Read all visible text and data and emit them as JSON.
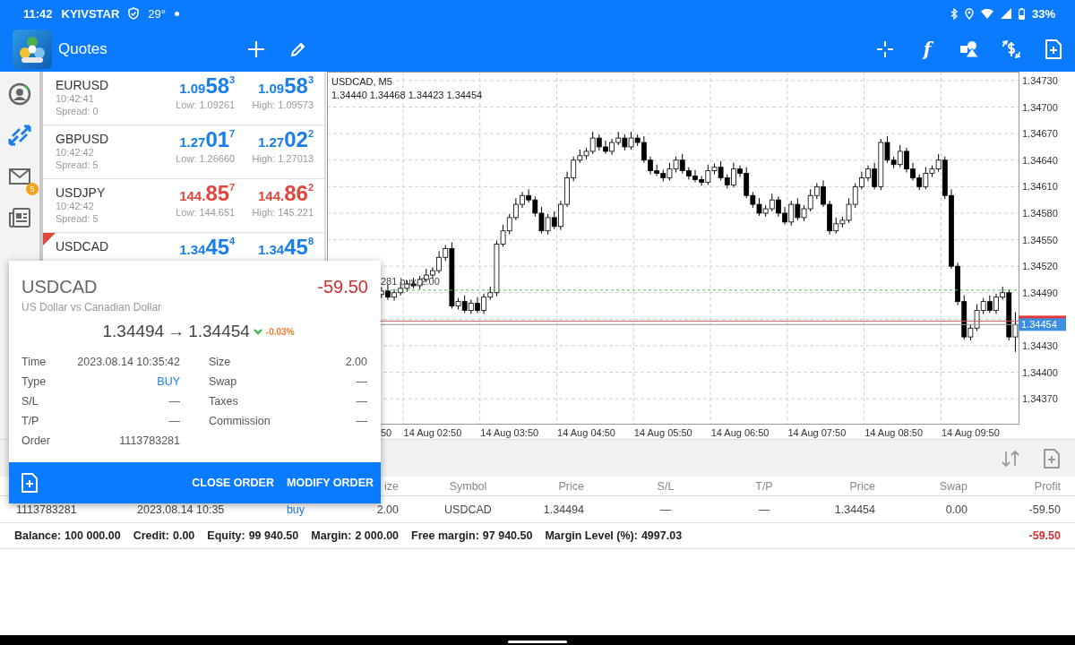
{
  "status_bar": {
    "time": "11:42",
    "carrier": "KYIVSTAR",
    "temperature": "29°",
    "battery": "33%"
  },
  "app_bar": {
    "title": "Quotes",
    "indicator_glyph": "f"
  },
  "side_nav": [
    {
      "kind": "account",
      "selected": false
    },
    {
      "kind": "trade",
      "selected": true
    },
    {
      "kind": "mail",
      "selected": false,
      "badge": "5"
    },
    {
      "kind": "news",
      "selected": false
    }
  ],
  "quotes": [
    {
      "symbol": "EURUSD",
      "time": "10:42:41",
      "spread": "Spread: 0",
      "color": "#1a7ee8",
      "flagged": false,
      "bid": {
        "head": "1.09",
        "pips": "58",
        "point": "3"
      },
      "ask": {
        "head": "1.09",
        "pips": "58",
        "point": "3"
      },
      "low": "Low: 1.09261",
      "high": "High: 1.09573"
    },
    {
      "symbol": "GBPUSD",
      "time": "10:42:42",
      "spread": "Spread: 5",
      "color": "#1a7ee8",
      "flagged": false,
      "bid": {
        "head": "1.27",
        "pips": "01",
        "point": "7"
      },
      "ask": {
        "head": "1.27",
        "pips": "02",
        "point": "2"
      },
      "low": "Low: 1.26660",
      "high": "High: 1.27013"
    },
    {
      "symbol": "USDJPY",
      "time": "10:42:42",
      "spread": "Spread: 5",
      "color": "#e0473c",
      "flagged": false,
      "bid": {
        "head": "144.",
        "pips": "85",
        "point": "7"
      },
      "ask": {
        "head": "144.",
        "pips": "86",
        "point": "2"
      },
      "low": "Low: 144.651",
      "high": "High: 145.221"
    },
    {
      "symbol": "USDCAD",
      "color": "#1a7ee8",
      "flagged": true,
      "bid": {
        "head": "1.34",
        "pips": "45",
        "point": "4"
      },
      "ask": {
        "head": "1.34",
        "pips": "45",
        "point": "8"
      }
    }
  ],
  "chart": {
    "ohlc_text": "1.34440 1.34468 1.34423 1.34454",
    "cut_axis_label": "50",
    "chart_data": {
      "type": "candlestick",
      "title": "USDCAD, M5",
      "grid": true,
      "categories": [
        null,
        null,
        null,
        null,
        null,
        null,
        null,
        null,
        null,
        null,
        null,
        null,
        null,
        null,
        null,
        null,
        "14 Aug 02:50",
        null,
        null,
        null,
        null,
        null,
        null,
        null,
        null,
        null,
        null,
        null,
        "14 Aug 03:50",
        null,
        null,
        null,
        null,
        null,
        null,
        null,
        null,
        null,
        null,
        null,
        "14 Aug 04:50",
        null,
        null,
        null,
        null,
        null,
        null,
        null,
        null,
        null,
        null,
        null,
        "14 Aug 05:50",
        null,
        null,
        null,
        null,
        null,
        null,
        null,
        null,
        null,
        null,
        null,
        "14 Aug 06:50",
        null,
        null,
        null,
        null,
        null,
        null,
        null,
        null,
        null,
        null,
        null,
        "14 Aug 07:50",
        null,
        null,
        null,
        null,
        null,
        null,
        null,
        null,
        null,
        null,
        null,
        "14 Aug 08:50",
        null,
        null,
        null,
        null,
        null,
        null,
        null,
        null,
        null,
        null,
        null,
        "14 Aug 09:50",
        null,
        null,
        null,
        null,
        null,
        null,
        null
      ],
      "ohlc": [
        null,
        null,
        null,
        null,
        null,
        null,
        null,
        null,
        [
          1.34488,
          1.34496,
          1.34484,
          1.34492
        ],
        [
          1.34492,
          1.34499,
          1.34482,
          1.34485
        ],
        [
          1.34485,
          1.34494,
          1.34481,
          1.3449
        ],
        [
          1.3449,
          1.34502,
          1.34487,
          1.34495
        ],
        [
          1.34495,
          1.34504,
          1.34491,
          1.345
        ],
        [
          1.345,
          1.34507,
          1.34495,
          1.34498
        ],
        [
          1.34498,
          1.34509,
          1.34494,
          1.34505
        ],
        [
          1.34505,
          1.34517,
          1.34502,
          1.3451
        ],
        [
          1.3451,
          1.34519,
          1.34506,
          1.34515
        ],
        [
          1.34515,
          1.34537,
          1.34512,
          1.3453
        ],
        [
          1.3453,
          1.34544,
          1.34526,
          1.3454
        ],
        [
          1.3454,
          1.34547,
          1.34472,
          1.34475
        ],
        [
          1.34475,
          1.34484,
          1.34471,
          1.3448
        ],
        [
          1.3448,
          1.34487,
          1.34467,
          1.3447
        ],
        [
          1.3447,
          1.34482,
          1.34466,
          1.34478
        ],
        [
          1.34478,
          1.34485,
          1.34467,
          1.3447
        ],
        [
          1.3447,
          1.34489,
          1.34466,
          1.34485
        ],
        [
          1.34485,
          1.34497,
          1.34482,
          1.3449
        ],
        [
          1.3449,
          1.34549,
          1.34486,
          1.34545
        ],
        [
          1.34545,
          1.34567,
          1.34542,
          1.3456
        ],
        [
          1.3456,
          1.34579,
          1.34556,
          1.34575
        ],
        [
          1.34575,
          1.34597,
          1.34572,
          1.3459
        ],
        [
          1.3459,
          1.34604,
          1.34586,
          1.346
        ],
        [
          1.346,
          1.34607,
          1.34592,
          1.34595
        ],
        [
          1.34595,
          1.34599,
          1.34576,
          1.3458
        ],
        [
          1.3458,
          1.34587,
          1.34557,
          1.3456
        ],
        [
          1.3456,
          1.34579,
          1.34556,
          1.34575
        ],
        [
          1.34575,
          1.34582,
          1.34562,
          1.34565
        ],
        [
          1.34565,
          1.34594,
          1.34561,
          1.3459
        ],
        [
          1.3459,
          1.34627,
          1.34587,
          1.3462
        ],
        [
          1.3462,
          1.34644,
          1.34616,
          1.3464
        ],
        [
          1.3464,
          1.34652,
          1.34637,
          1.34645
        ],
        [
          1.34645,
          1.34654,
          1.34641,
          1.3465
        ],
        [
          1.3465,
          1.34672,
          1.34647,
          1.34665
        ],
        [
          1.34665,
          1.34669,
          1.34651,
          1.34655
        ],
        [
          1.34655,
          1.34662,
          1.34647,
          1.3465
        ],
        [
          1.3465,
          1.34664,
          1.34646,
          1.3466
        ],
        [
          1.3466,
          1.34672,
          1.34657,
          1.34665
        ],
        [
          1.34665,
          1.34669,
          1.34651,
          1.34655
        ],
        [
          1.34655,
          1.34672,
          1.34652,
          1.34665
        ],
        [
          1.34665,
          1.34669,
          1.34656,
          1.3466
        ],
        [
          1.3466,
          1.34667,
          1.34637,
          1.3464
        ],
        [
          1.3464,
          1.34644,
          1.34624,
          1.34628
        ],
        [
          1.34628,
          1.34635,
          1.34622,
          1.34625
        ],
        [
          1.34625,
          1.34629,
          1.34616,
          1.3462
        ],
        [
          1.3462,
          1.34637,
          1.34617,
          1.3463
        ],
        [
          1.3463,
          1.34644,
          1.34626,
          1.3464
        ],
        [
          1.3464,
          1.34647,
          1.34625,
          1.34628
        ],
        [
          1.34628,
          1.34632,
          1.34618,
          1.34622
        ],
        [
          1.34622,
          1.34629,
          1.34615,
          1.34618
        ],
        [
          1.34618,
          1.34622,
          1.34611,
          1.34615
        ],
        [
          1.34615,
          1.34635,
          1.34612,
          1.34628
        ],
        [
          1.34628,
          1.34636,
          1.34624,
          1.34632
        ],
        [
          1.34632,
          1.34639,
          1.34617,
          1.3462
        ],
        [
          1.3462,
          1.34624,
          1.34608,
          1.34612
        ],
        [
          1.34612,
          1.34637,
          1.34609,
          1.3463
        ],
        [
          1.3463,
          1.34634,
          1.34621,
          1.34625
        ],
        [
          1.34625,
          1.34632,
          1.34597,
          1.346
        ],
        [
          1.346,
          1.34604,
          1.34586,
          1.3459
        ],
        [
          1.3459,
          1.34597,
          1.34577,
          1.3458
        ],
        [
          1.3458,
          1.34589,
          1.34576,
          1.34585
        ],
        [
          1.34585,
          1.34602,
          1.34582,
          1.34595
        ],
        [
          1.34595,
          1.34599,
          1.34576,
          1.3458
        ],
        [
          1.3458,
          1.34587,
          1.34567,
          1.3457
        ],
        [
          1.3457,
          1.34594,
          1.34566,
          1.3459
        ],
        [
          1.3459,
          1.34597,
          1.34572,
          1.34575
        ],
        [
          1.34575,
          1.34589,
          1.34571,
          1.34585
        ],
        [
          1.34585,
          1.34607,
          1.34582,
          1.346
        ],
        [
          1.346,
          1.34614,
          1.34596,
          1.3461
        ],
        [
          1.3461,
          1.34617,
          1.34587,
          1.3459
        ],
        [
          1.3459,
          1.34594,
          1.34556,
          1.3456
        ],
        [
          1.3456,
          1.34575,
          1.34557,
          1.34568
        ],
        [
          1.34568,
          1.34576,
          1.34564,
          1.34572
        ],
        [
          1.34572,
          1.34597,
          1.34569,
          1.3459
        ],
        [
          1.3459,
          1.34614,
          1.34586,
          1.3461
        ],
        [
          1.3461,
          1.34627,
          1.34607,
          1.3462
        ],
        [
          1.3462,
          1.34634,
          1.34616,
          1.3463
        ],
        [
          1.3463,
          1.34637,
          1.34607,
          1.3461
        ],
        [
          1.3461,
          1.34664,
          1.34606,
          1.3466
        ],
        [
          1.3466,
          1.34667,
          1.34637,
          1.3464
        ],
        [
          1.3464,
          1.34644,
          1.34631,
          1.34635
        ],
        [
          1.34635,
          1.34657,
          1.34632,
          1.3465
        ],
        [
          1.3465,
          1.34654,
          1.34626,
          1.3463
        ],
        [
          1.3463,
          1.34637,
          1.34617,
          1.3462
        ],
        [
          1.3462,
          1.34624,
          1.34606,
          1.3461
        ],
        [
          1.3461,
          1.34632,
          1.34607,
          1.34625
        ],
        [
          1.34625,
          1.34634,
          1.34621,
          1.3463
        ],
        [
          1.3463,
          1.34647,
          1.34627,
          1.3464
        ],
        [
          1.3464,
          1.34644,
          1.34596,
          1.346
        ],
        [
          1.346,
          1.34607,
          1.34517,
          1.3452
        ],
        [
          1.3452,
          1.34524,
          1.34476,
          1.3448
        ],
        [
          1.3448,
          1.34487,
          1.34437,
          1.3444
        ],
        [
          1.3444,
          1.34454,
          1.34436,
          1.3445
        ],
        [
          1.3445,
          1.34477,
          1.34447,
          1.3447
        ],
        [
          1.3447,
          1.34484,
          1.34466,
          1.3448
        ],
        [
          1.3448,
          1.34487,
          1.34467,
          1.3447
        ],
        [
          1.3447,
          1.34489,
          1.34466,
          1.34485
        ],
        [
          1.34485,
          1.34497,
          1.34482,
          1.3449
        ],
        [
          1.3449,
          1.34494,
          1.34436,
          1.3444
        ],
        [
          1.3444,
          1.34468,
          1.34423,
          1.34454
        ]
      ],
      "ylim": [
        1.343418,
        1.347401
      ],
      "ref_lines": [
        {
          "axis": "y",
          "value": 1.34493,
          "label": "281 buy, 2.00",
          "color": "#5cb85c"
        },
        {
          "axis": "y",
          "value": 1.34458,
          "color": "#d9534f"
        },
        {
          "axis": "y",
          "value": 1.34454,
          "label": "1.34454",
          "color": "#8a9aa8"
        }
      ],
      "yticks": [
        {
          "value": 1.3473,
          "label": "1.34730"
        },
        {
          "value": 1.347,
          "label": "1.34700"
        },
        {
          "value": 1.3467,
          "label": "1.34670"
        },
        {
          "value": 1.3464,
          "label": "1.34640"
        },
        {
          "value": 1.3461,
          "label": "1.34610"
        },
        {
          "value": 1.3458,
          "label": "1.34580"
        },
        {
          "value": 1.3455,
          "label": "1.34550"
        },
        {
          "value": 1.3452,
          "label": "1.34520"
        },
        {
          "value": 1.3449,
          "label": "1.34490"
        },
        {
          "value": 1.3443,
          "label": "1.34430"
        },
        {
          "value": 1.344,
          "label": "1.34400"
        },
        {
          "value": 1.3437,
          "label": "1.34370"
        }
      ]
    }
  },
  "order_popup": {
    "symbol": "USDCAD",
    "description": "US Dollar vs Canadian Dollar",
    "profit": "-59.50",
    "open_price": "1.34494",
    "arrow": "→",
    "current_price": "1.34454",
    "change": "-0.03%",
    "left_details": [
      {
        "label": "Time",
        "value": "2023.08.14 10:35:42",
        "emphasis": false
      },
      {
        "label": "Type",
        "value": "BUY",
        "emphasis": true
      },
      {
        "label": "S/L",
        "value": "—",
        "emphasis": false
      },
      {
        "label": "T/P",
        "value": "—",
        "emphasis": false
      },
      {
        "label": "Order",
        "value": "1113783281",
        "emphasis": false
      }
    ],
    "right_details": [
      {
        "label": "Size",
        "value": "2.00",
        "emphasis": false
      },
      {
        "label": "Swap",
        "value": "—",
        "emphasis": false
      },
      {
        "label": "Taxes",
        "value": "—",
        "emphasis": false
      },
      {
        "label": "Commission",
        "value": "—",
        "emphasis": false
      }
    ],
    "buttons": [
      "CLOSE ORDER",
      "MODIFY ORDER"
    ]
  },
  "trade_table": {
    "columns": [
      "",
      "",
      "",
      "ize",
      "Symbol",
      "Price",
      "S/L",
      "T/P",
      "Price",
      "Swap",
      "Profit"
    ],
    "rows": [
      [
        "1113783281",
        "2023.08.14 10:35",
        "buy",
        "2.00",
        "USDCAD",
        "1.34494",
        "—",
        "—",
        "1.34454",
        "0.00",
        "-59.50"
      ]
    ]
  },
  "summary": {
    "items": [
      {
        "label": "Balance:",
        "value": "100 000.00"
      },
      {
        "label": "Credit:",
        "value": "0.00"
      },
      {
        "label": "Equity:",
        "value": "99 940.50"
      },
      {
        "label": "Margin:",
        "value": "2 000.00"
      },
      {
        "label": "Free margin:",
        "value": "97 940.50"
      },
      {
        "label": "Margin Level (%):",
        "value": "4997.03"
      }
    ],
    "total": "-59.50"
  }
}
